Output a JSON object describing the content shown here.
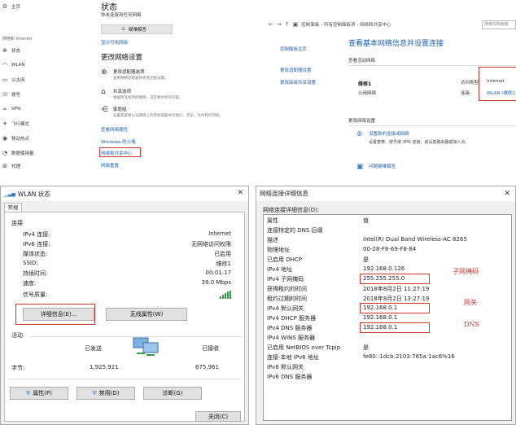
{
  "settings": {
    "sidebar": {
      "home": "主页",
      "category": "网络和 Internet",
      "items": [
        "状态",
        "WLAN",
        "以太网",
        "拨号",
        "VPN",
        "飞行模式",
        "移动热点",
        "数据使用量",
        "代理"
      ]
    },
    "title": "状态",
    "conn_line1": "你未连接到任何网络",
    "conn_line2": "",
    "trouble_button": "疑难解答",
    "available_link": "显示可用网络",
    "change_title": "更改网络设置",
    "options": [
      {
        "title": "更改适配器选项",
        "desc": "查看网络适配器并更改连接设置。"
      },
      {
        "title": "共享选项",
        "desc": "根据所连接到的网络，决定要共享的内容。"
      },
      {
        "title": "家庭组",
        "desc": "设置家庭组以与网络上的其他电脑共享图片、音乐、文件和打印机。"
      }
    ],
    "links": [
      "查看网络属性",
      "Windows 防火墙",
      "网络和共享中心",
      "网络重置"
    ]
  },
  "nsc": {
    "address_path": "控制面板 › 所有控制面板项 › 网络和共享中心",
    "search_placeholder": "搜索控制面板",
    "left_links": [
      "控制面板主页",
      "更改适配器设置",
      "更改高级共享设置"
    ],
    "title": "查看基本网络信息并设置连接",
    "active_section": "查看活动网络",
    "network_name": "维修1",
    "network_type": "公用网络",
    "access_label": "访问类型:",
    "access_value": "Internet",
    "conn_label": "连接:",
    "conn_value": "WLAN (维修1)",
    "change_section": "更改网络设置",
    "tasks": [
      {
        "title": "设置新的连接或网络",
        "desc": "设置宽带、拨号或 VPN 连接；或设置路由器或接入点。"
      },
      {
        "title": "问题疑难解答",
        "desc": ""
      }
    ]
  },
  "wlan": {
    "title": "WLAN 状态",
    "close": "✕",
    "tab": "常规",
    "connection_group": "连接",
    "rows": [
      {
        "label": "IPv4 连接:",
        "value": "Internet"
      },
      {
        "label": "IPv6 连接:",
        "value": "无网络访问权限"
      },
      {
        "label": "媒体状态:",
        "value": "已启用"
      },
      {
        "label": "SSID:",
        "value": "维修1"
      },
      {
        "label": "持续时间:",
        "value": "00:01:17"
      },
      {
        "label": "速度:",
        "value": "39.0 Mbps"
      }
    ],
    "signal_label": "信号质量:",
    "details_button": "详细信息(E)...",
    "wireless_button": "无线属性(W)",
    "activity_group": "活动",
    "sent_label": "已发送",
    "received_label": "已接收",
    "bytes_label": "字节:",
    "bytes_sent": "1,925,921",
    "bytes_received": "675,961",
    "properties_button": "属性(P)",
    "disable_button": "禁用(D)",
    "diagnose_button": "诊断(G)",
    "close_button": "关闭(C)"
  },
  "details": {
    "title": "网络连接详细信息",
    "close": "✕",
    "caption": "网络连接详细信息(D):",
    "header": {
      "property": "属性",
      "value": "值"
    },
    "rows": [
      {
        "p": "连接特定的 DNS 后缀",
        "v": ""
      },
      {
        "p": "描述",
        "v": "Intel(R) Dual Band Wireless-AC 8265"
      },
      {
        "p": "物理地址",
        "v": "00-28-F8-69-F8-84"
      },
      {
        "p": "已启用 DHCP",
        "v": "是"
      },
      {
        "p": "IPv4 地址",
        "v": "192.168.0.126"
      },
      {
        "p": "IPv4 子网掩码",
        "v": "255.255.255.0"
      },
      {
        "p": "获得租约的时间",
        "v": "2018年8月2日 11:27:19"
      },
      {
        "p": "租约过期的时间",
        "v": "2018年8月2日 13:27:19"
      },
      {
        "p": "IPv4 默认网关",
        "v": "192.168.0.1"
      },
      {
        "p": "IPv4 DHCP 服务器",
        "v": "192.168.0.1"
      },
      {
        "p": "IPv4 DNS 服务器",
        "v": "192.168.0.1"
      },
      {
        "p": "IPv4 WINS 服务器",
        "v": ""
      },
      {
        "p": "已启用 NetBIOS over Tcpip",
        "v": "是"
      },
      {
        "p": "连接-本地 IPv6 地址",
        "v": "fe80::1dcb:2103:765a:1ac6%16"
      },
      {
        "p": "IPv6 默认网关",
        "v": ""
      },
      {
        "p": "IPv6 DNS 服务器",
        "v": ""
      }
    ],
    "annotations": {
      "subnet": "子网掩码",
      "gateway": "网关",
      "dns": "DNS"
    }
  }
}
